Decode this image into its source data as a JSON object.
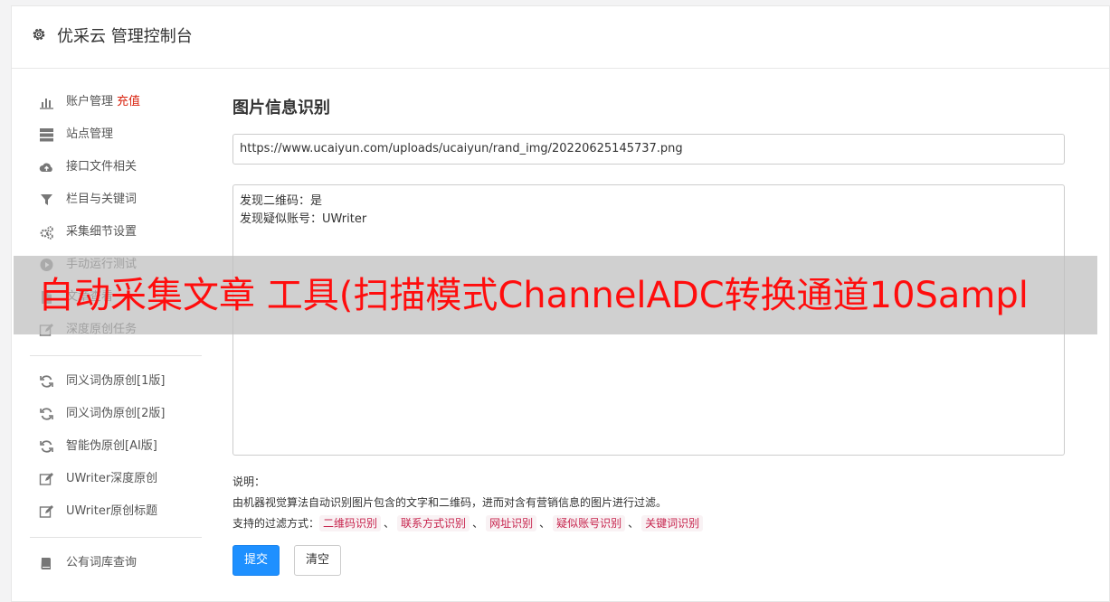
{
  "header": {
    "title": "优采云 管理控制台",
    "icon": "gear-icon"
  },
  "sidebar": {
    "group1": [
      {
        "icon": "bar-chart-icon",
        "label": "账户管理",
        "tag": "充值"
      },
      {
        "icon": "server-icon",
        "label": "站点管理"
      },
      {
        "icon": "cloud-upload-icon",
        "label": "接口文件相关"
      },
      {
        "icon": "filter-icon",
        "label": "栏目与关键词"
      },
      {
        "icon": "cogs-icon",
        "label": "采集细节设置"
      },
      {
        "icon": "play-circle-icon",
        "label": "手动运行测试"
      },
      {
        "icon": "file-icon",
        "label": "文章查看"
      },
      {
        "icon": "edit-icon",
        "label": "深度原创任务"
      }
    ],
    "group2": [
      {
        "icon": "refresh-icon",
        "label": "同义词伪原创[1版]"
      },
      {
        "icon": "refresh-icon",
        "label": "同义词伪原创[2版]"
      },
      {
        "icon": "refresh-icon",
        "label": "智能伪原创[AI版]"
      },
      {
        "icon": "edit-icon",
        "label": "UWriter深度原创"
      },
      {
        "icon": "edit-icon",
        "label": "UWriter原创标题"
      }
    ],
    "group3": [
      {
        "icon": "book-icon",
        "label": "公有词库查询"
      }
    ]
  },
  "main": {
    "title": "图片信息识别",
    "url_value": "https://www.ucaiyun.com/uploads/ucaiyun/rand_img/20220625145737.png",
    "result_lines": [
      "发现二维码：是",
      "发现疑似账号：UWriter"
    ],
    "notes": {
      "label": "说明：",
      "description": "由机器视觉算法自动识别图片包含的文字和二维码，进而对含有营销信息的图片进行过滤。",
      "filters_label": "支持的过滤方式：",
      "filters": [
        "二维码识别",
        "联系方式识别",
        "网址识别",
        "疑似账号识别",
        "关键词识别"
      ],
      "separator": "、"
    },
    "buttons": {
      "submit": "提交",
      "clear": "清空"
    }
  },
  "overlay": {
    "text": "自动采集文章 工具(扫描模式ChannelADC转换通道10Sampl"
  },
  "colors": {
    "accent": "#1e90ff",
    "tag": "#d9230f",
    "overlay_text": "#ff0d0d",
    "chip_text": "#c7254e",
    "chip_bg": "#f9f2f4"
  }
}
